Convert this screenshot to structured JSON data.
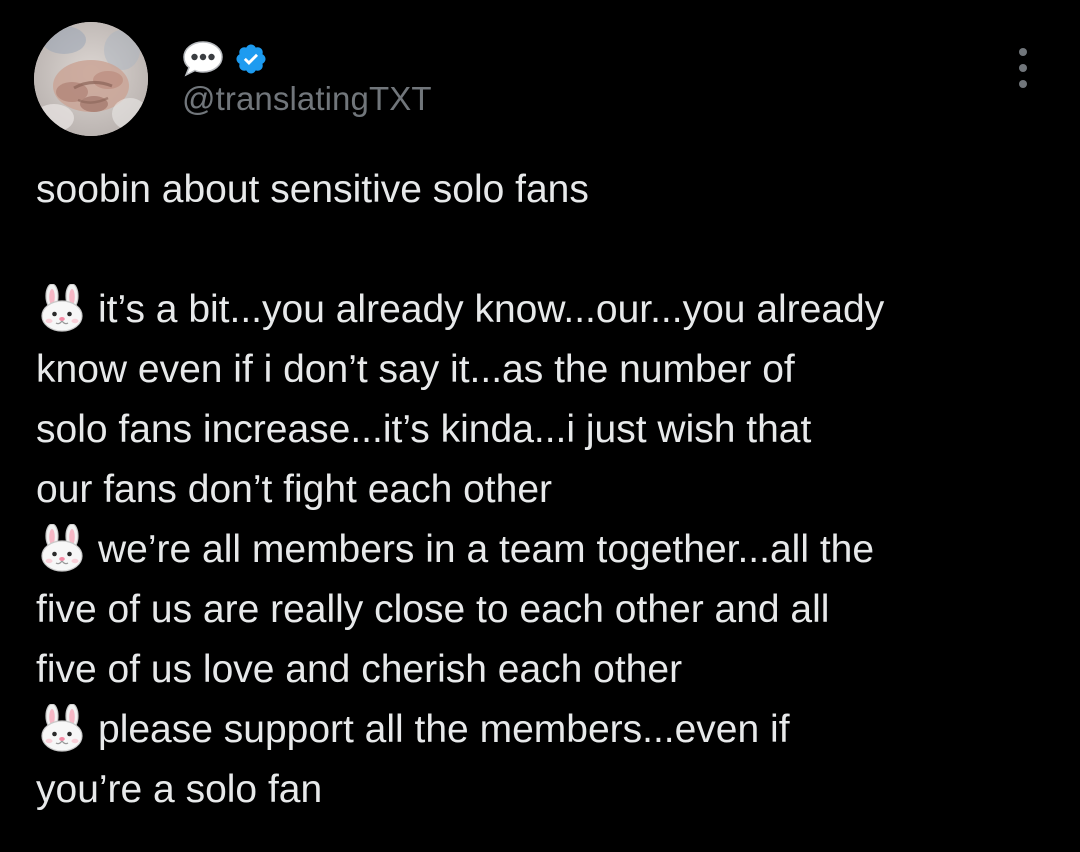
{
  "tweet": {
    "author": {
      "display_name_icon": "speech-bubble-emoji",
      "verified_icon": "verified-badge-icon",
      "verified_color": "#1d9bf0",
      "handle": "@translatingTXT"
    },
    "more_icon": "more-options-icon",
    "title": "soobin about sensitive solo fans",
    "bullet_icon": "rabbit-face-emoji",
    "paragraphs": [
      {
        "lines": [
          "it’s a bit...you already know...our...you already",
          "know even if i don’t say it...as the number of",
          "solo fans increase...it’s kinda...i just wish that",
          "our fans don’t fight each other"
        ]
      },
      {
        "lines": [
          "we’re all members in a team together...all the",
          "five of us are really close to each other and all",
          "five of us love and cherish each other"
        ]
      },
      {
        "lines": [
          "please support all the members...even if",
          "you’re a solo fan"
        ]
      }
    ]
  },
  "colors": {
    "background": "#000000",
    "text_primary": "#e7e9ea",
    "text_secondary": "#71767b",
    "accent": "#1d9bf0"
  }
}
